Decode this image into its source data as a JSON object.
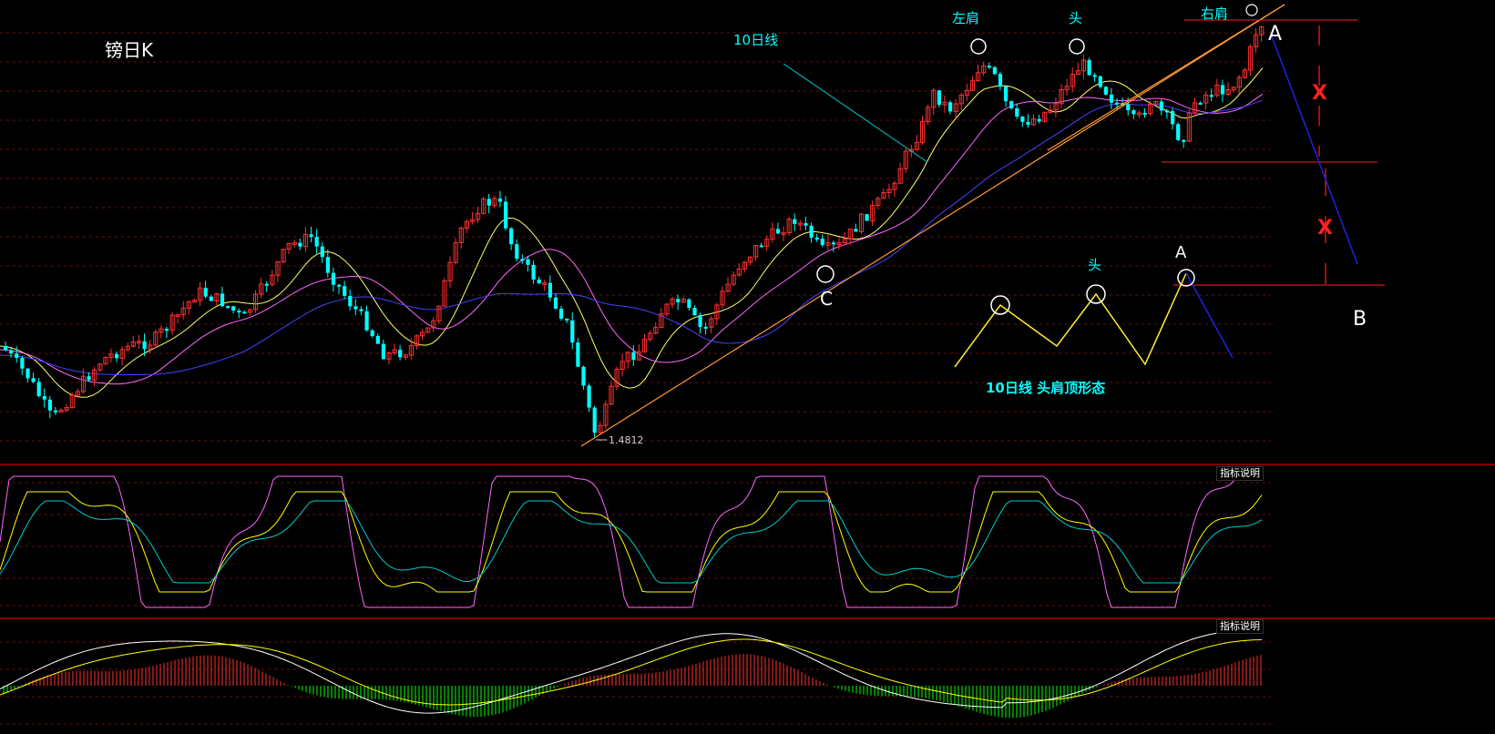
{
  "chart_data": [
    {
      "type": "candlestick",
      "title": "镑日K",
      "price_label": "1.4812",
      "annotations": {
        "ma_label": "10日线",
        "left_shoulder": "左肩",
        "head": "头",
        "right_shoulder": "右肩",
        "point_a": "A",
        "point_b": "B",
        "point_c": "C",
        "distance": "X",
        "inset_head": "头",
        "inset_a": "A",
        "inset_caption": "10日线 头肩顶形态"
      },
      "colors": {
        "up": "#ff3030",
        "down": "#00ffff",
        "ma_fast": "#ffff66",
        "ma_mid": "#ff66ff",
        "ma_slow": "#4444ff",
        "trendline": "#ff9933"
      }
    },
    {
      "type": "line",
      "indicator": "KDJ",
      "label": "指标说明",
      "colors": {
        "k": "#ffffff",
        "d": "#ffff00",
        "j": "#ff66ff",
        "extra": "#00cccc"
      }
    },
    {
      "type": "bar",
      "indicator": "MACD",
      "label": "指标说明",
      "colors": {
        "positive": "#ff3030",
        "negative": "#00ff00",
        "dif": "#ffffff",
        "dea": "#ffff00"
      }
    }
  ]
}
